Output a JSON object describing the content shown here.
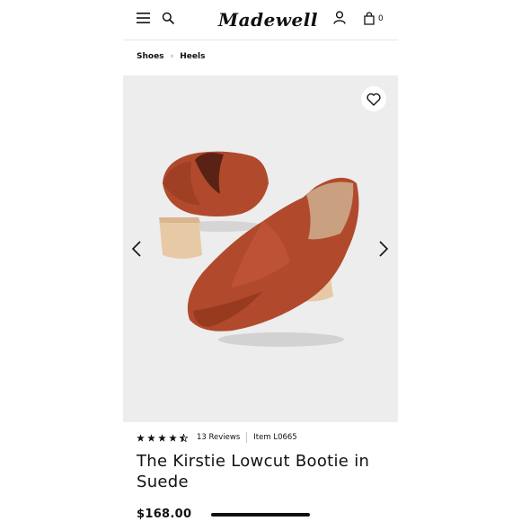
{
  "header": {
    "logo_text": "Madewell",
    "bag_count": "0",
    "icons": [
      "menu-icon",
      "search-icon",
      "account-icon",
      "shopping-bag-icon"
    ]
  },
  "breadcrumb": [
    {
      "label": "Shoes"
    },
    {
      "label": "Heels"
    }
  ],
  "product": {
    "rating": 4.5,
    "reviews": "13 Reviews",
    "item_number": "Item L0665",
    "title": "The Kirstie Lowcut Bootie in Suede",
    "price": "$168.00"
  },
  "colors": {
    "suede": "#b14a2c",
    "heel_wood": "#e8c9a6",
    "hero_bg": "#ededed"
  }
}
